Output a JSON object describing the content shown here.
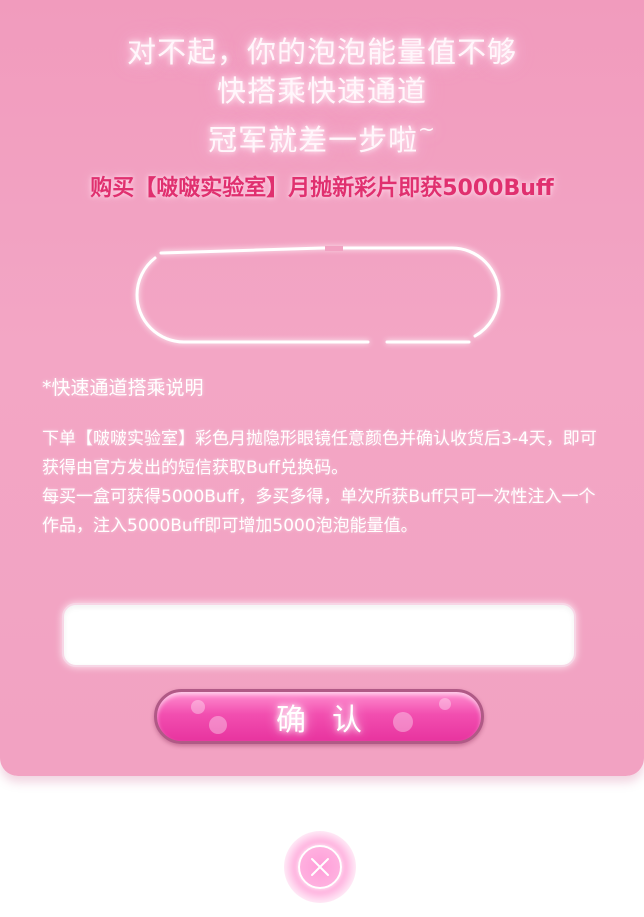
{
  "header": {
    "line1": "对不起，你的泡泡能量值不够",
    "line2": "快搭乘快速通道",
    "line3": "冠军就差一步啦",
    "line3_tilde": "~"
  },
  "promo": {
    "text": "购买【啵啵实验室】月抛新彩片即获5000Buff"
  },
  "instructions": {
    "title": "*快速通道搭乘说明",
    "paragraph1": "下单【啵啵实验室】彩色月抛隐形眼镜任意颜色并确认收货后3-4天，即可获得由官方发出的短信获取Buff兑换码。",
    "paragraph2": "每买一盒可获得5000Buff，多买多得，单次所获Buff只可一次性注入一个作品，注入5000Buff即可增加5000泡泡能量值。"
  },
  "code_input": {
    "value": "",
    "placeholder": ""
  },
  "confirm_button": {
    "label": "确认"
  },
  "icons": {
    "close": "close-icon",
    "capsule": "capsule-icon"
  },
  "colors": {
    "panel_bg": "#f2a2c2",
    "promo_text": "#e0306f",
    "button_bg": "#f24fb0",
    "button_border": "#b05a86"
  }
}
